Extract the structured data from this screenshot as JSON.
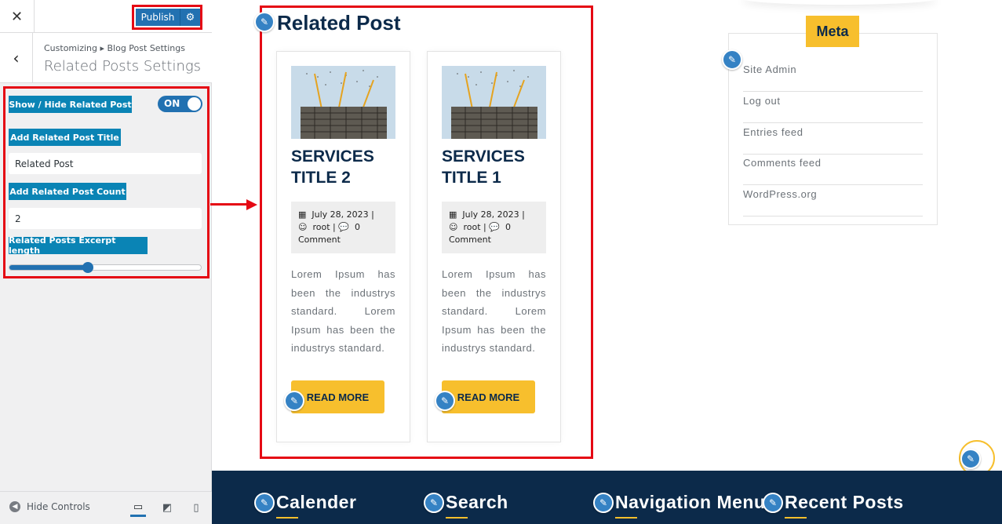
{
  "sidebar": {
    "close_label": "✕",
    "publish_label": "Publish",
    "back_label": "‹",
    "breadcrumb": "Customizing ▸ Blog Post Settings",
    "section_title": "Related Posts Settings",
    "controls": {
      "show_hide_label": "Show / Hide Related Post",
      "toggle_text": "ON",
      "title_label": "Add Related Post Title",
      "title_value": "Related Post",
      "count_label": "Add Related Post Count",
      "count_value": "2",
      "excerpt_label": "Related Posts Excerpt length",
      "excerpt_slider_fraction": 0.41
    },
    "footer": {
      "hide_controls": "Hide Controls",
      "devices": [
        "desktop-icon",
        "tablet-icon",
        "mobile-icon"
      ]
    }
  },
  "preview": {
    "related_title": "Related Post",
    "cards": [
      {
        "title_line1": "SERVICES",
        "title_line2": "TITLE 2",
        "date": "July 28, 2023",
        "author": "root",
        "comments": "0",
        "comment_word": "Comment",
        "excerpt": "Lorem Ipsum has been the industrys standard. Lorem Ipsum has been the industrys standard.",
        "button": "READ MORE"
      },
      {
        "title_line1": "SERVICES",
        "title_line2": "TITLE 1",
        "date": "July 28, 2023",
        "author": "root",
        "comments": "0",
        "comment_word": "Comment",
        "excerpt": "Lorem Ipsum has been the industrys standard. Lorem Ipsum has been the industrys standard.",
        "button": "READ MORE"
      }
    ],
    "meta_widget": {
      "title": "Meta",
      "links": [
        "Site Admin",
        "Log out",
        "Entries feed",
        "Comments feed",
        "WordPress.org"
      ]
    },
    "footer_widgets": [
      "Calender",
      "Search",
      "Navigation Menu",
      "Recent Posts"
    ]
  },
  "colors": {
    "accent_blue": "#2271b1",
    "label_blue": "#0a84b5",
    "navy": "#0c2a4a",
    "yellow": "#f7bf2d",
    "highlight_red": "#e50914"
  }
}
